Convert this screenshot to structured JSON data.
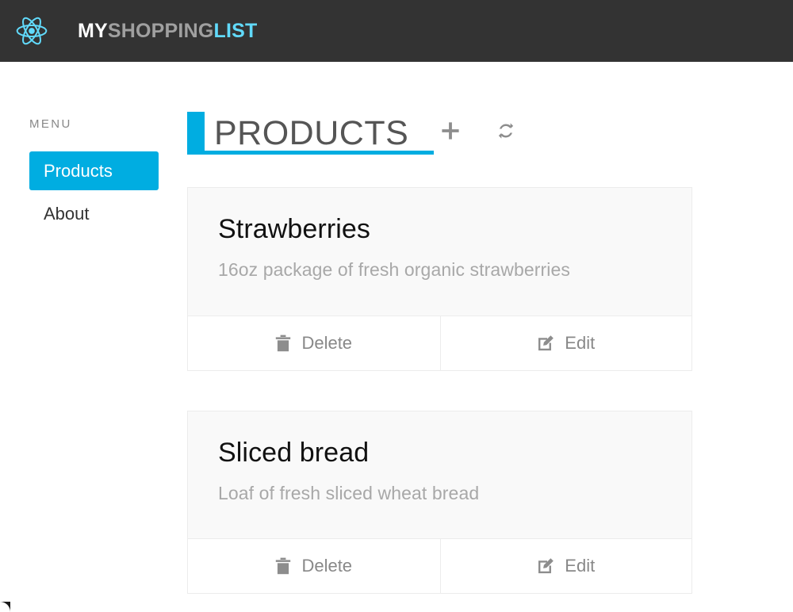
{
  "navbar": {
    "logo_icon": "react-atom-logo",
    "brand": {
      "part1": "MY",
      "part2": "SHOPPING",
      "part3": "LIST"
    },
    "colors": {
      "background": "#333333",
      "part1": "#ffffff",
      "part2": "#a0a0a0",
      "part3": "#61dafb"
    }
  },
  "sidebar": {
    "heading": "MENU",
    "items": [
      {
        "label": "Products",
        "active": true
      },
      {
        "label": "About",
        "active": false
      }
    ]
  },
  "main": {
    "title": "PRODUCTS",
    "accent_color": "#00ade1",
    "actions": [
      {
        "name": "add-product-button",
        "icon": "plus-icon",
        "label": ""
      },
      {
        "name": "refresh-button",
        "icon": "refresh-icon",
        "label": ""
      }
    ],
    "products": [
      {
        "name": "Strawberries",
        "description": "16oz package of fresh organic strawberries",
        "delete_label": "Delete",
        "edit_label": "Edit"
      },
      {
        "name": "Sliced bread",
        "description": "Loaf of fresh sliced wheat bread",
        "delete_label": "Delete",
        "edit_label": "Edit"
      }
    ]
  }
}
